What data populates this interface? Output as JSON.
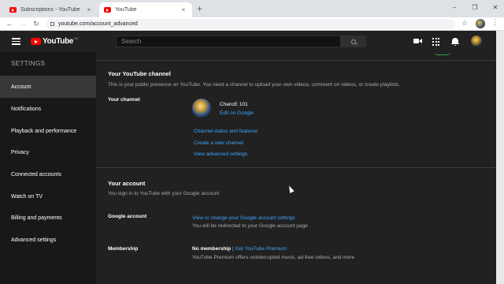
{
  "browser": {
    "tabs": [
      {
        "title": "Subscriptions - YouTube",
        "close": "×"
      },
      {
        "title": "YouTube",
        "close": "×"
      }
    ],
    "new_tab": "+",
    "window_controls": {
      "minimize": "–",
      "maximize": "❐",
      "close": "✕"
    },
    "nav": {
      "back": "←",
      "forward": "→",
      "reload": "↻"
    },
    "url": "youtube.com/account_advanced",
    "star": "☆",
    "menu": "⋮"
  },
  "masthead": {
    "logo_text": "YouTube",
    "logo_country": "NZ",
    "search_placeholder": "Search"
  },
  "sidebar": {
    "title": "SETTINGS",
    "items": [
      {
        "label": "Account",
        "active": true
      },
      {
        "label": "Notifications"
      },
      {
        "label": "Playback and performance"
      },
      {
        "label": "Privacy"
      },
      {
        "label": "Connected accounts"
      },
      {
        "label": "Watch on TV"
      },
      {
        "label": "Billing and payments"
      },
      {
        "label": "Advanced settings"
      }
    ]
  },
  "channel_section": {
    "title": "Your YouTube channel",
    "description": "This is your public presence on YouTube. You need a channel to upload your own videos, comment on videos, or create playlists.",
    "row_label": "Your channel",
    "channel_name": "ChancE 101",
    "edit_link": "Edit on Google",
    "links": [
      "Channel status and features",
      "Create a new channel",
      "View advanced settings"
    ]
  },
  "account_section": {
    "title": "Your account",
    "description": "You sign in to YouTube with your Google account",
    "google_label": "Google account",
    "google_link": "View or change your Google account settings",
    "google_note": "You will be redirected to your Google account page",
    "membership_label": "Membership",
    "membership_status": "No membership",
    "membership_separator": " | ",
    "membership_link": "Get YouTube Premium",
    "membership_note": "YouTube Premium offers uninterrupted music, ad-free videos, and more"
  },
  "colors": {
    "accent_link": "#3ea6ff",
    "brand_red": "#ff0000",
    "background": "#212121"
  }
}
